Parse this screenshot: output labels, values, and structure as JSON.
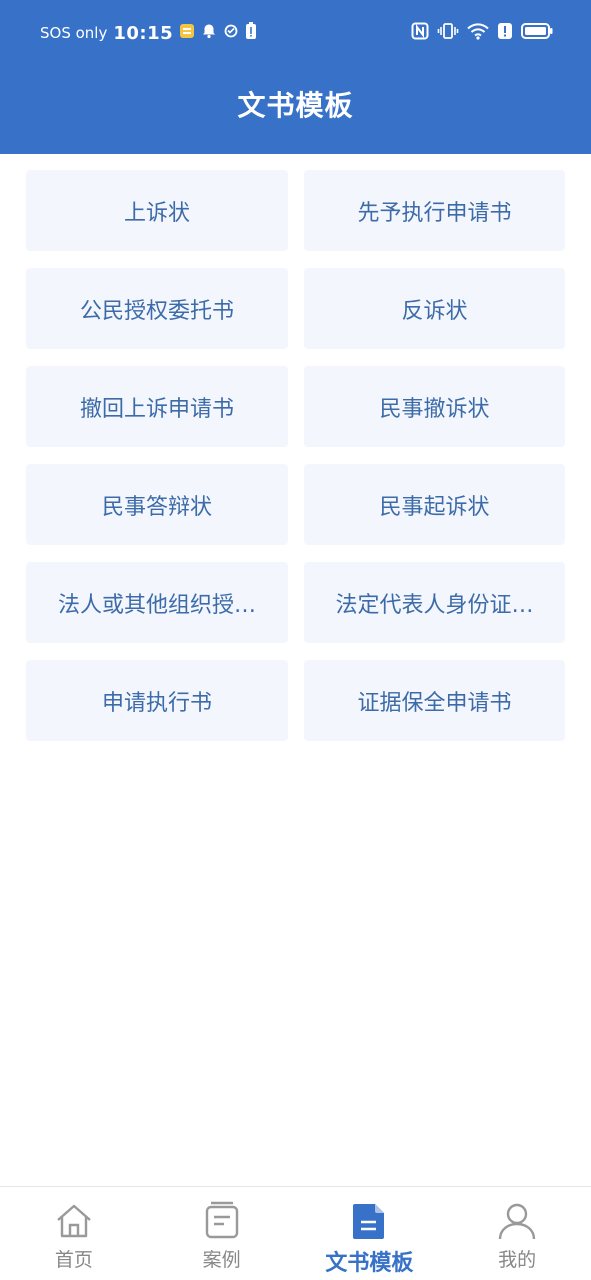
{
  "status_bar": {
    "sos": "SOS only",
    "time": "10:15"
  },
  "header": {
    "title": "文书模板"
  },
  "templates": [
    {
      "label": "上诉状"
    },
    {
      "label": "先予执行申请书"
    },
    {
      "label": "公民授权委托书"
    },
    {
      "label": "反诉状"
    },
    {
      "label": "撤回上诉申请书"
    },
    {
      "label": "民事撤诉状"
    },
    {
      "label": "民事答辩状"
    },
    {
      "label": "民事起诉状"
    },
    {
      "label": "法人或其他组织授…"
    },
    {
      "label": "法定代表人身份证…"
    },
    {
      "label": "申请执行书"
    },
    {
      "label": "证据保全申请书"
    }
  ],
  "bottom_nav": {
    "items": [
      {
        "label": "首页",
        "icon": "home-icon"
      },
      {
        "label": "案例",
        "icon": "case-icon"
      },
      {
        "label": "文书模板",
        "icon": "document-icon",
        "active": true
      },
      {
        "label": "我的",
        "icon": "user-icon"
      }
    ]
  },
  "colors": {
    "primary": "#3772C8",
    "card_bg": "#F3F7FD",
    "card_text": "#3D6BA9",
    "inactive": "#888888"
  }
}
